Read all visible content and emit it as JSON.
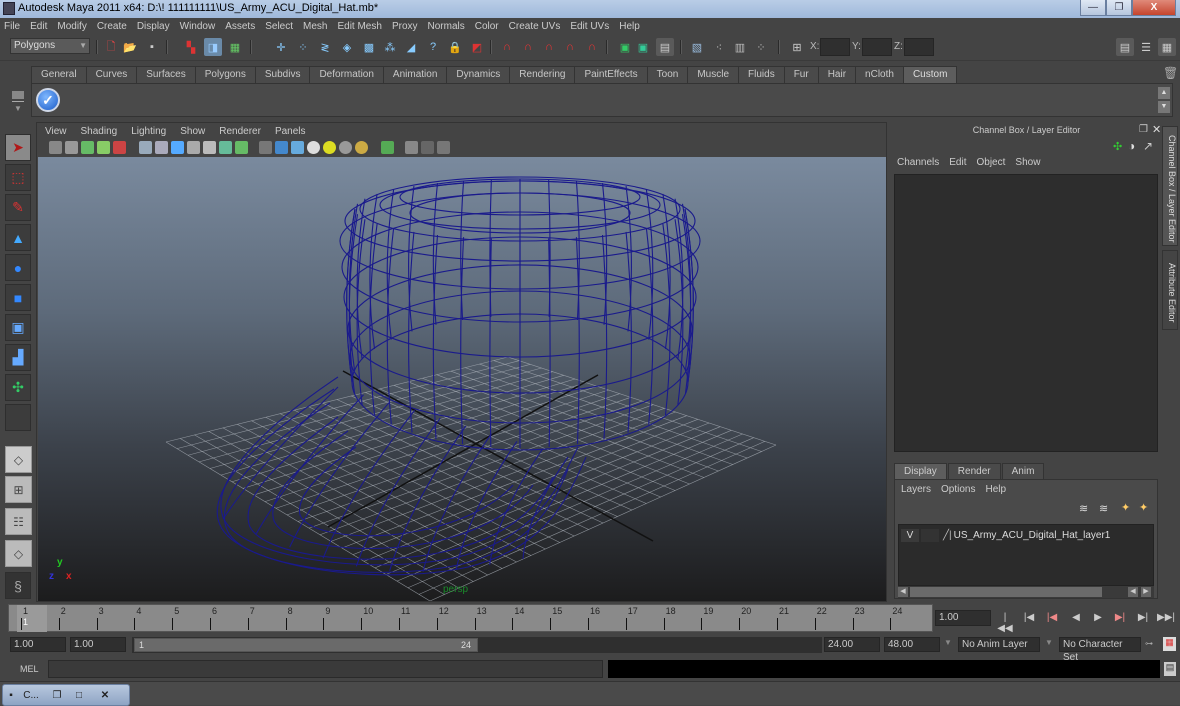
{
  "window": {
    "title": "Autodesk Maya 2011 x64: D:\\! 111111111\\US_Army_ACU_Digital_Hat.mb*",
    "minimize_label": "—",
    "restore_label": "❐",
    "close_label": "X"
  },
  "menubar": [
    "File",
    "Edit",
    "Modify",
    "Create",
    "Display",
    "Window",
    "Assets",
    "Select",
    "Mesh",
    "Edit Mesh",
    "Proxy",
    "Normals",
    "Color",
    "Create UVs",
    "Edit UVs",
    "Help"
  ],
  "statusline": {
    "mode_selector": "Polygons",
    "x_label": "X:",
    "y_label": "Y:",
    "z_label": "Z:",
    "x_value": "",
    "y_value": "",
    "z_value": ""
  },
  "shelf": {
    "tabs": [
      "General",
      "Curves",
      "Surfaces",
      "Polygons",
      "Subdivs",
      "Deformation",
      "Animation",
      "Dynamics",
      "Rendering",
      "PaintEffects",
      "Toon",
      "Muscle",
      "Fluids",
      "Fur",
      "Hair",
      "nCloth",
      "Custom"
    ],
    "active_tab": "Custom",
    "items": [
      {
        "icon": "checkmark-icon",
        "glyph": "✓"
      }
    ]
  },
  "toolbox": {
    "tools": [
      {
        "name": "select-tool",
        "glyph": "➤",
        "active": true
      },
      {
        "name": "lasso-tool",
        "glyph": "⬚"
      },
      {
        "name": "paint-select-tool",
        "glyph": "✎"
      },
      {
        "name": "move-tool-cone",
        "glyph": "▲"
      },
      {
        "name": "rotate-tool",
        "glyph": "●"
      },
      {
        "name": "scale-tool",
        "glyph": "■"
      },
      {
        "name": "universal-manipulator",
        "glyph": "▣"
      },
      {
        "name": "soft-modification-tool",
        "glyph": "▟"
      },
      {
        "name": "show-manipulator-tool",
        "glyph": "✣"
      },
      {
        "name": "last-tool-slot",
        "glyph": ""
      }
    ],
    "layouts": [
      "single-perspective-layout",
      "four-view-layout",
      "outliner-persp-layout",
      "persp-graph-layout"
    ]
  },
  "viewport": {
    "menus": [
      "View",
      "Shading",
      "Lighting",
      "Show",
      "Renderer",
      "Panels"
    ],
    "camera_name": "persp",
    "axis_labels": {
      "x": "x",
      "y": "y",
      "z": "z"
    },
    "wire_color": "#1a1a8c"
  },
  "channel_box": {
    "title": "Channel Box / Layer Editor",
    "menus": [
      "Channels",
      "Edit",
      "Object",
      "Show"
    ]
  },
  "side_tabs": [
    "Channel Box / Layer Editor",
    "Attribute Editor"
  ],
  "layer_editor": {
    "tabs": [
      "Display",
      "Render",
      "Anim"
    ],
    "active_tab": "Display",
    "menus": [
      "Layers",
      "Options",
      "Help"
    ],
    "layers": [
      {
        "visible": "V",
        "name": "US_Army_ACU_Digital_Hat_layer1"
      }
    ]
  },
  "timeslider": {
    "ticks": [
      "1",
      "2",
      "3",
      "4",
      "5",
      "6",
      "7",
      "8",
      "9",
      "10",
      "11",
      "12",
      "13",
      "14",
      "15",
      "16",
      "17",
      "18",
      "19",
      "20",
      "21",
      "22",
      "23",
      "24"
    ],
    "current_frame_label": "1",
    "current_time": "1.00"
  },
  "playback": [
    "|◀◀",
    "|◀",
    "|◀",
    "◀",
    "▶",
    "▶|",
    "▶|",
    "▶▶|"
  ],
  "range": {
    "start_time": "1.00",
    "playback_start": "1.00",
    "range_start_label": "1",
    "range_end_label": "24",
    "playback_end": "24.00",
    "end_time": "48.00",
    "anim_layer": "No Anim Layer",
    "character_set": "No Character Set"
  },
  "command_line": {
    "label": "MEL",
    "input": "",
    "output": ""
  },
  "taskbar": {
    "minimized_window_label": "C..."
  }
}
